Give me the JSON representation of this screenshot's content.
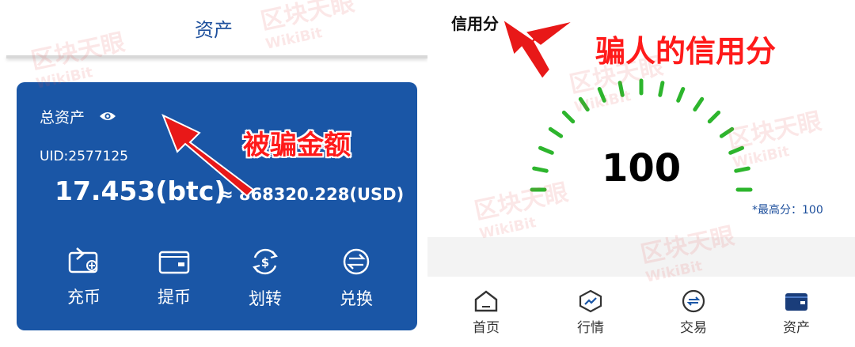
{
  "left": {
    "header_title": "资产",
    "card": {
      "total_label": "总资产",
      "uid": "UID:2577125",
      "btc_amount": "17.453(btc)",
      "usd_amount": "≈ 868320.228(USD)"
    },
    "actions": [
      {
        "label": "充币",
        "icon": "deposit-icon"
      },
      {
        "label": "提币",
        "icon": "withdraw-icon"
      },
      {
        "label": "划转",
        "icon": "transfer-icon"
      },
      {
        "label": "兑换",
        "icon": "exchange-icon"
      }
    ],
    "annotation": "被骗金额"
  },
  "right": {
    "credit_label": "信用分",
    "score": "100",
    "max_score": "*最高分：100",
    "annotation": "骗人的信用分",
    "nav": [
      {
        "label": "首页",
        "icon": "home-icon"
      },
      {
        "label": "行情",
        "icon": "market-icon"
      },
      {
        "label": "交易",
        "icon": "trade-icon"
      },
      {
        "label": "资产",
        "icon": "wallet-icon",
        "active": true
      }
    ]
  },
  "watermark": {
    "text": "区块天眼",
    "sub": "WikiBit"
  },
  "colors": {
    "primary_blue": "#1a56a6",
    "gauge_green": "#2db52d",
    "annotation_red": "#ff1a1a",
    "nav_active": "#1a3d7a"
  }
}
